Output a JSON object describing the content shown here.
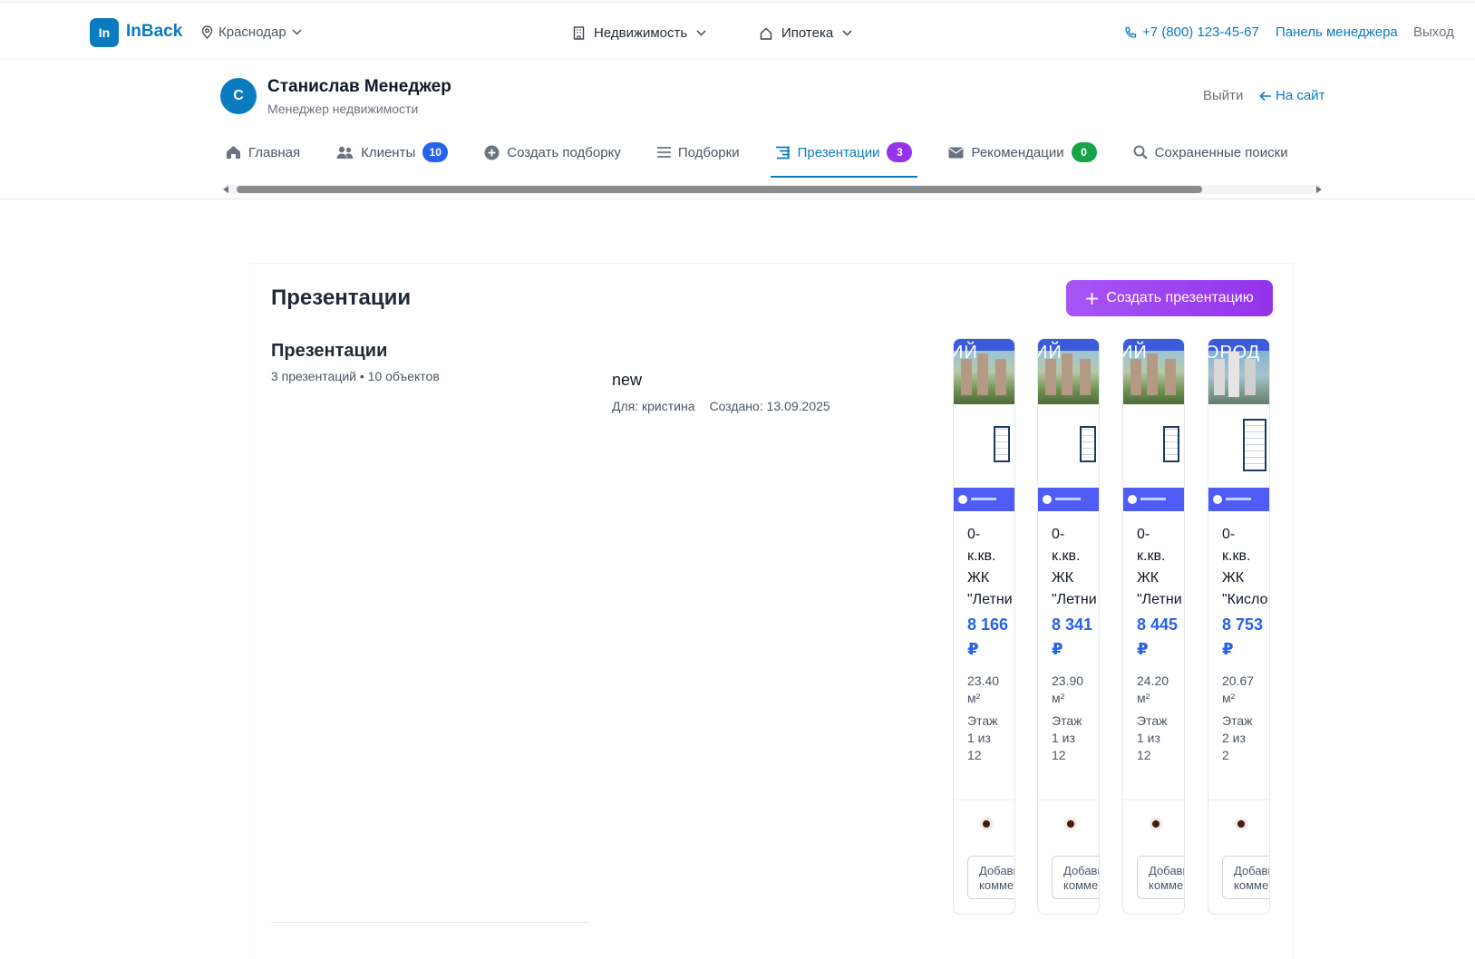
{
  "topbar": {
    "logo_initials": "In",
    "logo_name": "InBack",
    "city": "Краснодар",
    "nav_realty": "Недвижимость",
    "nav_mortgage": "Ипотека",
    "phone": "+7 (800) 123-45-67",
    "manager_panel": "Панель менеджера",
    "logout": "Выход"
  },
  "profile": {
    "avatar_letter": "С",
    "name": "Станислав Менеджер",
    "role": "Менеджер недвижимости",
    "exit": "Выйти",
    "to_site": "На сайт"
  },
  "tabs": [
    {
      "label": "Главная",
      "icon": "home-icon"
    },
    {
      "label": "Клиенты",
      "icon": "users-icon",
      "badge": "10"
    },
    {
      "label": "Создать подборку",
      "icon": "plus-circle-icon"
    },
    {
      "label": "Подборки",
      "icon": "list-icon"
    },
    {
      "label": "Презентации",
      "icon": "presentation-icon",
      "badge": "3",
      "active": true
    },
    {
      "label": "Рекомендации",
      "icon": "envelope-icon",
      "badge": "0"
    },
    {
      "label": "Сохраненные поиски",
      "icon": "search-icon"
    }
  ],
  "main": {
    "page_title": "Презентации",
    "create_button": "Создать презентацию",
    "section_title": "Презентации",
    "summary": "3 презентаций • 10 объектов",
    "presentation": {
      "title": "new",
      "for": "Для: кристина",
      "created": "Создано: 13.09.2025"
    }
  },
  "cards": [
    {
      "photo_text": "ИЙ",
      "title_lines": [
        "0-",
        "к.кв.",
        "ЖК",
        "\"Летни"
      ],
      "price_lines": [
        "8 166",
        "₽"
      ],
      "area_lines": [
        "23.40",
        "м²"
      ],
      "floor_lines": [
        "Этаж",
        "1 из",
        "12"
      ],
      "comment_lines": [
        "Добави",
        "комме"
      ]
    },
    {
      "photo_text": "ИЙ",
      "title_lines": [
        "0-",
        "к.кв.",
        "ЖК",
        "\"Летни"
      ],
      "price_lines": [
        "8 341",
        "₽"
      ],
      "area_lines": [
        "23.90",
        "м²"
      ],
      "floor_lines": [
        "Этаж",
        "1 из",
        "12"
      ],
      "comment_lines": [
        "Добави",
        "комме"
      ]
    },
    {
      "photo_text": "ИЙ",
      "title_lines": [
        "0-",
        "к.кв.",
        "ЖК",
        "\"Летни"
      ],
      "price_lines": [
        "8 445",
        "₽"
      ],
      "area_lines": [
        "24.20",
        "м²"
      ],
      "floor_lines": [
        "Этаж",
        "1 из",
        "12"
      ],
      "comment_lines": [
        "Добави",
        "комме"
      ]
    },
    {
      "photo_text": "ОРОД",
      "title_lines": [
        "0-",
        "к.кв.",
        "ЖК",
        "\"Кисло"
      ],
      "price_lines": [
        "8 753",
        "₽"
      ],
      "area_lines": [
        "20.67",
        "м²"
      ],
      "floor_lines": [
        "Этаж",
        "2 из",
        "2"
      ],
      "comment_lines": [
        "Добави",
        "комме"
      ]
    }
  ],
  "colors": {
    "brand": "#0b7bc0",
    "accent_purple": "#9333ea",
    "price_blue": "#2563eb",
    "badge_green": "#16a34a"
  }
}
